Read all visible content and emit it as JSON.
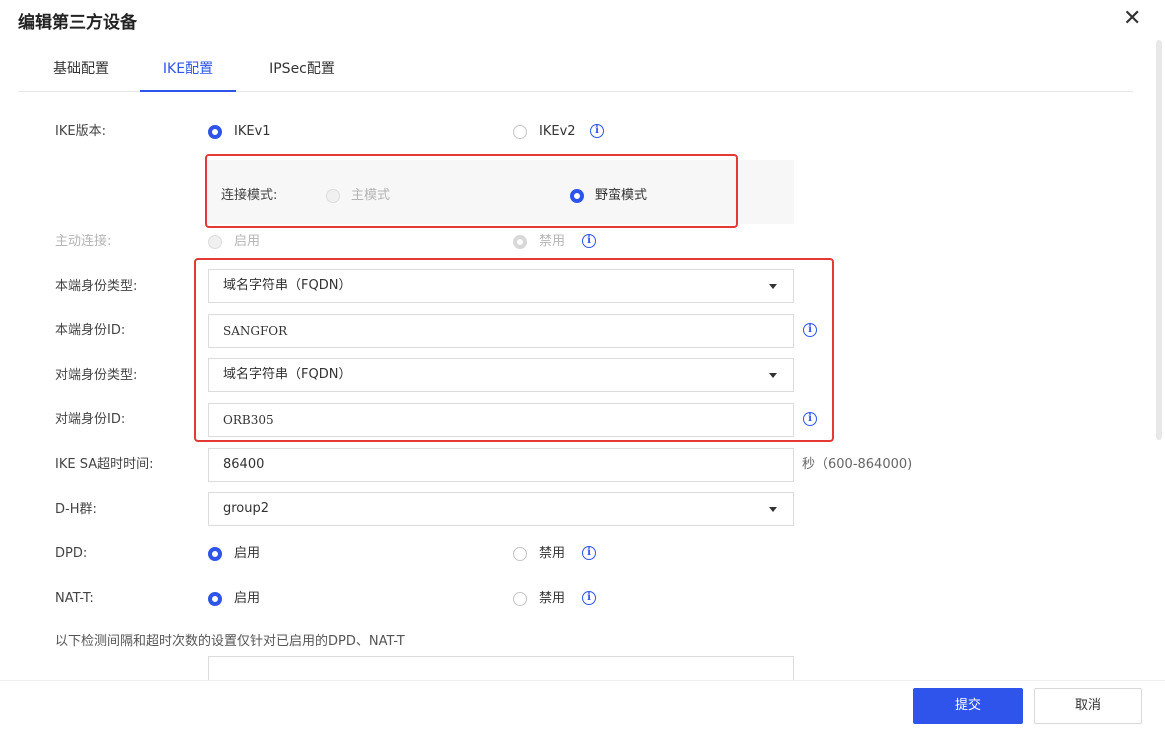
{
  "dialog": {
    "title": "编辑第三方设备",
    "close_icon": "close-icon"
  },
  "tabs": [
    {
      "label": "基础配置"
    },
    {
      "label": "IKE配置"
    },
    {
      "label": "IPSec配置"
    }
  ],
  "active_tab": "IKE配置",
  "form": {
    "ike_version": {
      "label": "IKE版本:",
      "opt1": "IKEv1",
      "opt2": "IKEv2",
      "selected": "IKEv1"
    },
    "connect_mode": {
      "label": "连接模式:",
      "opt1": "主模式",
      "opt2": "野蛮模式",
      "selected": "野蛮模式"
    },
    "active_connect": {
      "label": "主动连接:",
      "opt1": "启用",
      "opt2": "禁用",
      "selected": "禁用"
    },
    "local_id_type": {
      "label": "本端身份类型:",
      "value": "域名字符串（FQDN）"
    },
    "local_id": {
      "label": "本端身份ID:",
      "value": "SANGFOR"
    },
    "peer_id_type": {
      "label": "对端身份类型:",
      "value": "域名字符串（FQDN）"
    },
    "peer_id": {
      "label": "对端身份ID:",
      "value": "ORB305"
    },
    "ike_sa_timeout": {
      "label": "IKE SA超时时间:",
      "value": "86400",
      "hint": "秒（600-864000)"
    },
    "dh_group": {
      "label": "D-H群:",
      "value": "group2"
    },
    "dpd": {
      "label": "DPD:",
      "opt1": "启用",
      "opt2": "禁用",
      "selected": "启用"
    },
    "nat_t": {
      "label": "NAT-T:",
      "opt1": "启用",
      "opt2": "禁用",
      "selected": "启用"
    },
    "note": "以下检测间隔和超时次数的设置仅针对已启用的DPD、NAT-T"
  },
  "buttons": {
    "submit": "提交",
    "cancel": "取消"
  },
  "colors": {
    "accent": "#2f54eb",
    "highlight": "#e53935"
  }
}
